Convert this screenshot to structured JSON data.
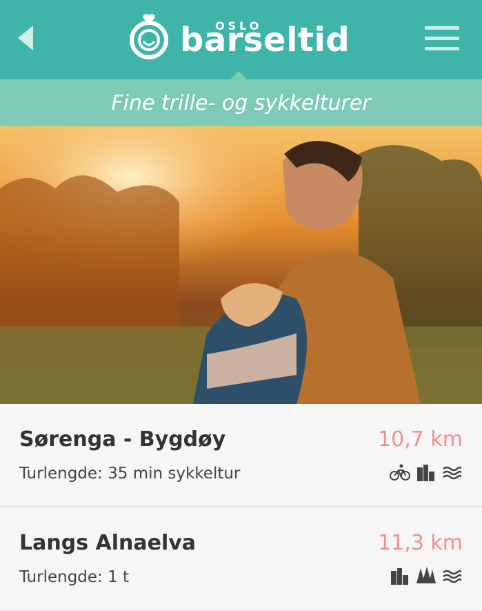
{
  "header": {
    "logo_small": "OSLO",
    "logo_main": "barseltid",
    "back_icon": "chevron-left-icon",
    "menu_icon": "hamburger-menu-icon",
    "bg_color": "#3fb5aa"
  },
  "subheader": {
    "title": "Fine trille- og sykkelturer",
    "bg_color": "#7dcab7"
  },
  "routes": [
    {
      "name": "Sørenga - Bygdøy",
      "duration": "Turlengde: 35 min sykkeltur",
      "distance": "10,7 km",
      "icons": [
        "bicycle-icon",
        "city-icon",
        "water-icon"
      ]
    },
    {
      "name": "Langs Alnaelva",
      "duration": "Turlengde: 1 t",
      "distance": "11,3 km",
      "icons": [
        "city-icon",
        "forest-icon",
        "water-icon"
      ]
    }
  ],
  "colors": {
    "distance": "#f28e8e"
  }
}
